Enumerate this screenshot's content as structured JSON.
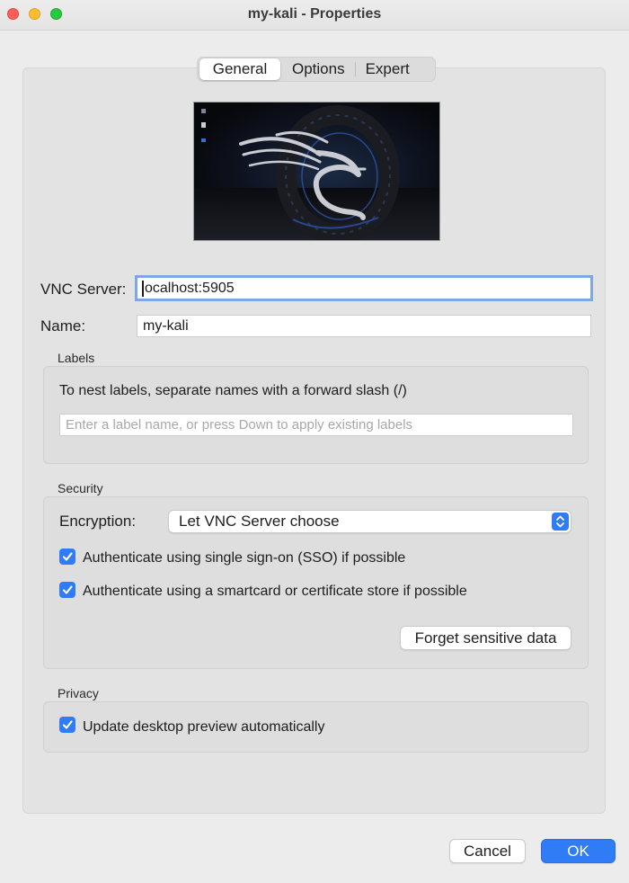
{
  "window": {
    "title": "my-kali - Properties"
  },
  "tabs": [
    {
      "label": "General",
      "active": true
    },
    {
      "label": "Options",
      "active": false
    },
    {
      "label": "Expert",
      "active": false
    }
  ],
  "general": {
    "vnc_server": {
      "label": "VNC Server:",
      "value": "localhost:5905",
      "display_value": "ocalhost:5905"
    },
    "name": {
      "label": "Name:",
      "value": "my-kali"
    }
  },
  "labels": {
    "title": "Labels",
    "hint": "To nest labels, separate names with a forward slash (/)",
    "input_placeholder": "Enter a label name, or press Down to apply existing labels"
  },
  "security": {
    "title": "Security",
    "encryption_label": "Encryption:",
    "encryption_value": "Let VNC Server choose",
    "checkboxes": [
      {
        "label": "Authenticate using single sign-on (SSO) if possible",
        "checked": true
      },
      {
        "label": "Authenticate using a smartcard or certificate store if possible",
        "checked": true
      }
    ],
    "forget_button": "Forget sensitive data"
  },
  "privacy": {
    "title": "Privacy",
    "checkbox": {
      "label": "Update desktop preview automatically",
      "checked": true
    }
  },
  "footer": {
    "cancel": "Cancel",
    "ok": "OK"
  },
  "colors": {
    "accent": "#2f7cf6",
    "focus_ring": "#7ea7e6"
  }
}
